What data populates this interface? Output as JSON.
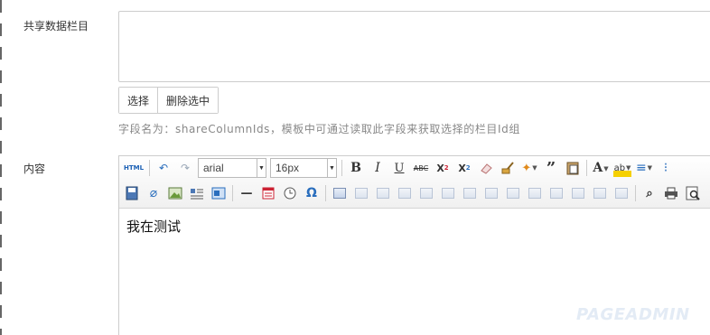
{
  "fields": {
    "share_label": "共享数据栏目",
    "content_label": "内容"
  },
  "buttons": {
    "select": "选择",
    "delete_selected": "删除选中"
  },
  "hint": "字段名为：shareColumnIds，模板中可通过读取此字段来获取选择的栏目Id组",
  "editor": {
    "font_family": "arial",
    "font_size": "16px",
    "content": "我在测试",
    "toolbar_row1": [
      {
        "name": "html-source-icon",
        "glyph": "HTML"
      },
      {
        "name": "undo-icon",
        "glyph": "↶"
      },
      {
        "name": "redo-icon",
        "glyph": "↷"
      },
      {
        "name": "bold-icon",
        "glyph": "B"
      },
      {
        "name": "italic-icon",
        "glyph": "I"
      },
      {
        "name": "underline-icon",
        "glyph": "U"
      },
      {
        "name": "strikethrough-icon",
        "glyph": "ABC"
      },
      {
        "name": "superscript-icon",
        "glyph": "X²"
      },
      {
        "name": "subscript-icon",
        "glyph": "X₂"
      },
      {
        "name": "eraser-icon",
        "glyph": "⌫"
      },
      {
        "name": "format-brush-icon",
        "glyph": "🖌"
      },
      {
        "name": "auto-format-icon",
        "glyph": "✨"
      },
      {
        "name": "blockquote-icon",
        "glyph": "❝"
      },
      {
        "name": "paste-text-icon",
        "glyph": "📋"
      },
      {
        "name": "font-color-icon",
        "glyph": "A"
      },
      {
        "name": "highlight-color-icon",
        "glyph": "ab"
      },
      {
        "name": "ordered-list-icon",
        "glyph": "≡"
      },
      {
        "name": "unordered-list-icon",
        "glyph": "⁝"
      }
    ],
    "toolbar_row2": [
      {
        "name": "save-icon",
        "glyph": "▣"
      },
      {
        "name": "attachment-icon",
        "glyph": "📎"
      },
      {
        "name": "image-icon",
        "glyph": "🖼"
      },
      {
        "name": "text-wrap-icon",
        "glyph": "☰"
      },
      {
        "name": "layout-icon",
        "glyph": "▤"
      },
      {
        "name": "horizontal-rule-icon",
        "glyph": "—"
      },
      {
        "name": "date-icon",
        "glyph": "▦"
      },
      {
        "name": "time-icon",
        "glyph": "◷"
      },
      {
        "name": "special-char-icon",
        "glyph": "Ω"
      },
      {
        "name": "insert-table-icon",
        "glyph": "▦"
      },
      {
        "name": "find-icon",
        "glyph": "⌕"
      },
      {
        "name": "print-icon",
        "glyph": "⎙"
      },
      {
        "name": "preview-icon",
        "glyph": "🔍"
      }
    ]
  },
  "watermark": "PAGEADMIN"
}
